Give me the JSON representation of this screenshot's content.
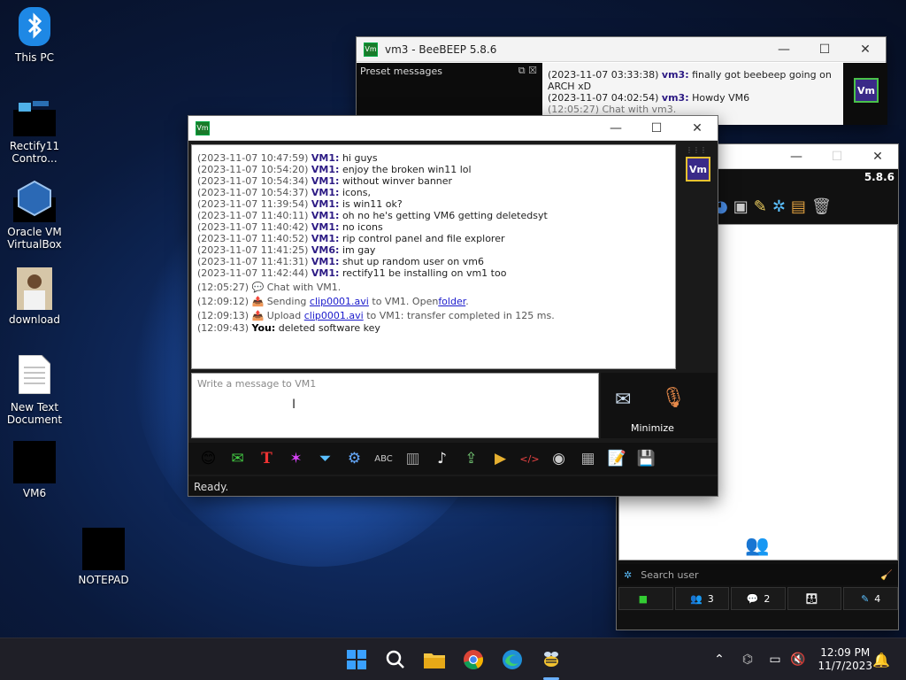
{
  "desktop": {
    "icons": [
      {
        "label": "This PC"
      },
      {
        "label": "Rectify11 Contro..."
      },
      {
        "label": "Oracle VM VirtualBox"
      },
      {
        "label": "download"
      },
      {
        "label": "New Text Document"
      },
      {
        "label": "VM6"
      },
      {
        "label": "NOTEPAD"
      }
    ]
  },
  "vm3_window": {
    "title": "vm3 - BeeBEEP 5.8.6",
    "preset_label": "Preset messages",
    "messages": [
      {
        "ts": "(2023-11-07 03:33:38)",
        "who": "vm3:",
        "text": "finally got beebeep going on ARCH xD"
      },
      {
        "ts": "(2023-11-07 04:02:54)",
        "who": "vm3:",
        "text": "Howdy VM6"
      },
      {
        "ts": "(12:05:27)",
        "who": "",
        "text": "Chat with vm3."
      }
    ],
    "avatar": "Vm"
  },
  "main_window": {
    "app_icon": "Vm",
    "avatar": "Vm",
    "messages": [
      {
        "ts": "(2023-11-07 10:47:59)",
        "who": "VM1:",
        "text": "hi guys"
      },
      {
        "ts": "(2023-11-07 10:54:20)",
        "who": "VM1:",
        "text": "enjoy the broken win11 lol"
      },
      {
        "ts": "(2023-11-07 10:54:34)",
        "who": "VM1:",
        "text": "without winver banner"
      },
      {
        "ts": "(2023-11-07 10:54:37)",
        "who": "VM1:",
        "text": "icons,"
      },
      {
        "ts": "(2023-11-07 11:39:54)",
        "who": "VM1:",
        "text": "is win11 ok?"
      },
      {
        "ts": "(2023-11-07 11:40:11)",
        "who": "VM1:",
        "text": "oh no he's getting VM6 getting deletedsyt"
      },
      {
        "ts": "(2023-11-07 11:40:42)",
        "who": "VM1:",
        "text": "no icons"
      },
      {
        "ts": "(2023-11-07 11:40:52)",
        "who": "VM1:",
        "text": "rip control panel and file explorer"
      },
      {
        "ts": "(2023-11-07 11:41:25)",
        "who": "VM6:",
        "text": "im gay"
      },
      {
        "ts": "(2023-11-07 11:41:31)",
        "who": "VM1:",
        "text": "shut up random user on vm6"
      },
      {
        "ts": "(2023-11-07 11:42:44)",
        "who": "VM1:",
        "text": "rectify11 be installing on vm1 too"
      }
    ],
    "system": {
      "chat_ts": "(12:05:27)",
      "chat_text": "Chat with VM1.",
      "send_ts": "(12:09:12)",
      "send_pre": "Sending",
      "send_file": "clip0001.avi",
      "send_mid": "to VM1. Open",
      "send_link": "folder",
      "send_end": ".",
      "up_ts": "(12:09:13)",
      "up_pre": "Upload",
      "up_file": "clip0001.avi",
      "up_post": "to VM1: transfer completed in 125 ms.",
      "you_ts": "(12:09:43)",
      "you_who": "You:",
      "you_text": "deleted software key"
    },
    "input_placeholder": "Write a message to VM1",
    "minimize_label": "Minimize",
    "status": "Ready."
  },
  "right_window": {
    "version": "5.8.6",
    "search_placeholder": "Search user",
    "tabs": [
      {
        "count": ""
      },
      {
        "count": "3"
      },
      {
        "count": "2"
      },
      {
        "count": ""
      },
      {
        "count": "4"
      }
    ]
  },
  "taskbar": {
    "time": "12:09 PM",
    "date": "11/7/2023"
  }
}
